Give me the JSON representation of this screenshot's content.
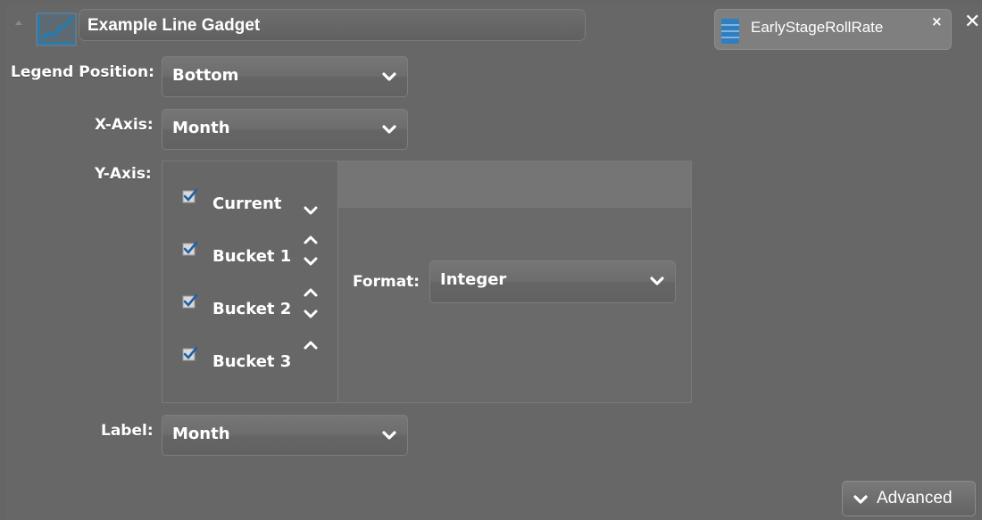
{
  "gadget": {
    "title": "Example Line Gadget",
    "icon": "line-chart-icon",
    "datasource": "EarlyStageRollRate",
    "datasource_icon": "database-icon",
    "datasource_remove": "×",
    "close": "✕"
  },
  "legend_position": {
    "label": "Legend Position:",
    "value": "Bottom"
  },
  "x_axis": {
    "label": "X-Axis:",
    "value": "Month"
  },
  "y_axis": {
    "label": "Y-Axis:",
    "series": [
      {
        "label": "Current",
        "checked": true
      },
      {
        "label": "Bucket 1",
        "checked": true
      },
      {
        "label": "Bucket 2",
        "checked": true
      },
      {
        "label": "Bucket 3",
        "checked": true
      }
    ],
    "format": {
      "label": "Format:",
      "value": "Integer"
    }
  },
  "label_field": {
    "label": "Label:",
    "value": "Month"
  },
  "advanced_button": {
    "label": "Advanced"
  },
  "colors": {
    "background": "#656565",
    "icon_blue": "#1e7fb8",
    "text": "#ffffff"
  }
}
